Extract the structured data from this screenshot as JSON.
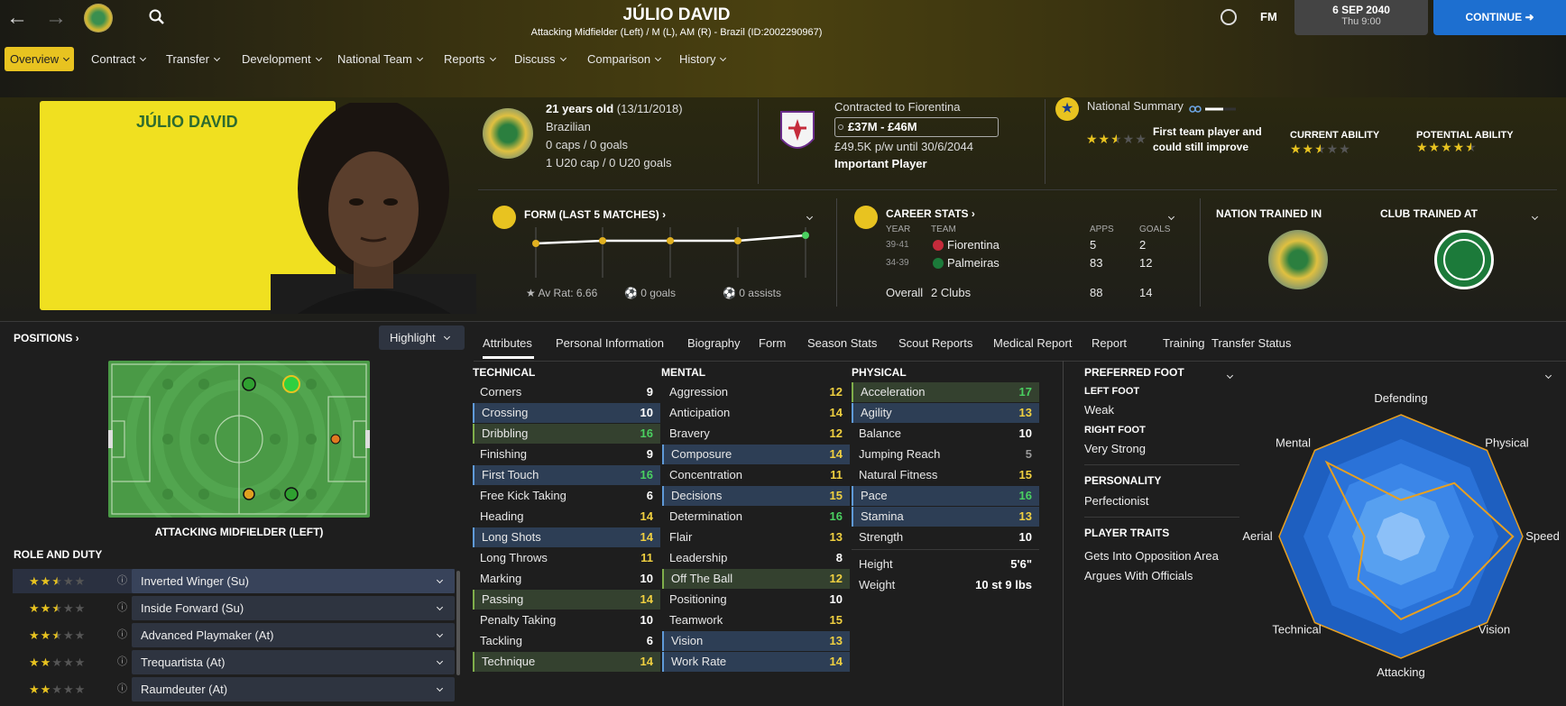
{
  "header": {
    "player_name": "JÚLIO DAVID",
    "subtitle": "Attacking Midfielder (Left) / M (L), AM (R) - Brazil (ID:2002290967)",
    "date": "6 SEP 2040",
    "time": "Thu 9:00",
    "continue_label": "CONTINUE",
    "fm_label": "FM"
  },
  "nav": [
    {
      "label": "Overview",
      "selected": true
    },
    {
      "label": "Contract"
    },
    {
      "label": "Transfer"
    },
    {
      "label": "Development"
    },
    {
      "label": "National Team"
    },
    {
      "label": "Reports"
    },
    {
      "label": "Discuss"
    },
    {
      "label": "Comparison"
    },
    {
      "label": "History"
    }
  ],
  "portrait_name": "JÚLIO DAVID",
  "bio": {
    "age": "21 years old",
    "dob": "(13/11/2018)",
    "nationality": "Brazilian",
    "caps": "0 caps / 0 goals",
    "u20": "1 U20 cap / 0 U20 goals"
  },
  "contract": {
    "club": "Contracted to Fiorentina",
    "value": "£37M - £46M",
    "wage": "£49.5K p/w until 30/6/2044",
    "status": "Important Player"
  },
  "summary": {
    "title": "National Summary",
    "desc_line1": "First team player and",
    "desc_line2": "could still improve",
    "current_label": "CURRENT ABILITY",
    "potential_label": "POTENTIAL ABILITY",
    "summary_stars": 2.5,
    "current_stars": 2.5,
    "potential_stars": 4.5
  },
  "form": {
    "title": "FORM (LAST 5 MATCHES)",
    "av_rat": "Av Rat: 6.66",
    "goals": "0 goals",
    "assists": "0 assists",
    "points": [
      6.6,
      6.65,
      6.65,
      6.65,
      6.75
    ]
  },
  "career": {
    "title": "CAREER STATS",
    "col_year": "YEAR",
    "col_team": "TEAM",
    "col_apps": "APPS",
    "col_goals": "GOALS",
    "rows": [
      {
        "year": "39-41",
        "team": "Fiorentina",
        "apps": "5",
        "goals": "2"
      },
      {
        "year": "34-39",
        "team": "Palmeiras",
        "apps": "83",
        "goals": "12"
      }
    ],
    "overall_label": "Overall",
    "overall_team": "2 Clubs",
    "overall_apps": "88",
    "overall_goals": "14"
  },
  "trained": {
    "nation_label": "NATION TRAINED IN",
    "club_label": "CLUB TRAINED AT"
  },
  "positions": {
    "title": "POSITIONS",
    "highlight": "Highlight",
    "position_label": "ATTACKING MIDFIELDER (LEFT)",
    "role_title": "ROLE AND DUTY"
  },
  "roles": [
    {
      "name": "Inverted Winger (Su)",
      "stars": 2.5
    },
    {
      "name": "Inside Forward (Su)",
      "stars": 2.5
    },
    {
      "name": "Advanced Playmaker (At)",
      "stars": 2.5
    },
    {
      "name": "Trequartista (At)",
      "stars": 2
    },
    {
      "name": "Raumdeuter (At)",
      "stars": 2
    }
  ],
  "tabs": [
    "Attributes",
    "Personal Information",
    "Biography",
    "Form",
    "Season Stats",
    "Scout Reports",
    "Medical Report",
    "Report",
    "Training",
    "Transfer Status"
  ],
  "attributes": {
    "technical_title": "TECHNICAL",
    "mental_title": "MENTAL",
    "physical_title": "PHYSICAL",
    "technical": [
      {
        "n": "Corners",
        "v": "9",
        "c": "white",
        "h": ""
      },
      {
        "n": "Crossing",
        "v": "10",
        "c": "white",
        "h": "blue"
      },
      {
        "n": "Dribbling",
        "v": "16",
        "c": "green",
        "h": "green"
      },
      {
        "n": "Finishing",
        "v": "9",
        "c": "white",
        "h": ""
      },
      {
        "n": "First Touch",
        "v": "16",
        "c": "green",
        "h": "blue"
      },
      {
        "n": "Free Kick Taking",
        "v": "6",
        "c": "white",
        "h": ""
      },
      {
        "n": "Heading",
        "v": "14",
        "c": "yellow",
        "h": ""
      },
      {
        "n": "Long Shots",
        "v": "14",
        "c": "yellow",
        "h": "blue"
      },
      {
        "n": "Long Throws",
        "v": "11",
        "c": "yellow",
        "h": ""
      },
      {
        "n": "Marking",
        "v": "10",
        "c": "white",
        "h": ""
      },
      {
        "n": "Passing",
        "v": "14",
        "c": "yellow",
        "h": "green"
      },
      {
        "n": "Penalty Taking",
        "v": "10",
        "c": "white",
        "h": ""
      },
      {
        "n": "Tackling",
        "v": "6",
        "c": "white",
        "h": ""
      },
      {
        "n": "Technique",
        "v": "14",
        "c": "yellow",
        "h": "green"
      }
    ],
    "mental": [
      {
        "n": "Aggression",
        "v": "12",
        "c": "yellow",
        "h": ""
      },
      {
        "n": "Anticipation",
        "v": "14",
        "c": "yellow",
        "h": ""
      },
      {
        "n": "Bravery",
        "v": "12",
        "c": "yellow",
        "h": ""
      },
      {
        "n": "Composure",
        "v": "14",
        "c": "yellow",
        "h": "blue"
      },
      {
        "n": "Concentration",
        "v": "11",
        "c": "yellow",
        "h": ""
      },
      {
        "n": "Decisions",
        "v": "15",
        "c": "yellow",
        "h": "blue"
      },
      {
        "n": "Determination",
        "v": "16",
        "c": "green",
        "h": ""
      },
      {
        "n": "Flair",
        "v": "13",
        "c": "yellow",
        "h": ""
      },
      {
        "n": "Leadership",
        "v": "8",
        "c": "white",
        "h": ""
      },
      {
        "n": "Off The Ball",
        "v": "12",
        "c": "yellow",
        "h": "green"
      },
      {
        "n": "Positioning",
        "v": "10",
        "c": "white",
        "h": ""
      },
      {
        "n": "Teamwork",
        "v": "15",
        "c": "yellow",
        "h": ""
      },
      {
        "n": "Vision",
        "v": "13",
        "c": "yellow",
        "h": "blue"
      },
      {
        "n": "Work Rate",
        "v": "14",
        "c": "yellow",
        "h": "blue"
      }
    ],
    "physical": [
      {
        "n": "Acceleration",
        "v": "17",
        "c": "green",
        "h": "green"
      },
      {
        "n": "Agility",
        "v": "13",
        "c": "yellow",
        "h": "blue"
      },
      {
        "n": "Balance",
        "v": "10",
        "c": "white",
        "h": ""
      },
      {
        "n": "Jumping Reach",
        "v": "5",
        "c": "grey",
        "h": ""
      },
      {
        "n": "Natural Fitness",
        "v": "15",
        "c": "yellow",
        "h": ""
      },
      {
        "n": "Pace",
        "v": "16",
        "c": "green",
        "h": "blue"
      },
      {
        "n": "Stamina",
        "v": "13",
        "c": "yellow",
        "h": "blue"
      },
      {
        "n": "Strength",
        "v": "10",
        "c": "white",
        "h": ""
      }
    ],
    "height_label": "Height",
    "height": "5'6\"",
    "weight_label": "Weight",
    "weight": "10 st 9 lbs"
  },
  "side": {
    "foot_title": "PREFERRED FOOT",
    "left_label": "LEFT FOOT",
    "left_val": "Weak",
    "right_label": "RIGHT FOOT",
    "right_val": "Very Strong",
    "personality_label": "PERSONALITY",
    "personality": "Perfectionist",
    "traits_label": "PLAYER TRAITS",
    "trait1": "Gets Into Opposition Area",
    "trait2": "Argues With Officials"
  },
  "radar": {
    "axes": [
      "Defending",
      "Physical",
      "Speed",
      "Vision",
      "Attacking",
      "Technical",
      "Aerial",
      "Mental"
    ],
    "values": [
      0.3,
      0.62,
      0.92,
      0.66,
      0.68,
      0.5,
      0.3,
      0.86
    ]
  },
  "colors": {
    "accent": "#e8c320",
    "continue": "#1d6fd0",
    "green": "#4ad060",
    "yellow": "#f0d040"
  }
}
